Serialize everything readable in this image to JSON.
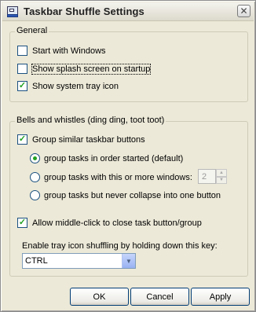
{
  "window": {
    "title": "Taskbar Shuffle Settings",
    "close_glyph": "✕"
  },
  "general": {
    "legend": "General",
    "items": [
      {
        "label": "Start with Windows",
        "checked": false
      },
      {
        "label": "Show splash screen on startup",
        "checked": false
      },
      {
        "label": "Show system tray icon",
        "checked": true
      }
    ]
  },
  "bells": {
    "legend": "Bells and whistles (ding ding, toot toot)",
    "group_similar": {
      "label": "Group similar taskbar buttons",
      "checked": true
    },
    "radios": [
      {
        "label": "group tasks in order started (default)",
        "selected": true
      },
      {
        "label": "group tasks with this or more windows:",
        "selected": false
      },
      {
        "label": "group tasks but never collapse into one button",
        "selected": false
      }
    ],
    "window_count": "2",
    "middle_click": {
      "label": "Allow middle-click to close task button/group",
      "checked": true
    },
    "tray_shuffle_label": "Enable tray icon shuffling by holding down this key:",
    "key_select_value": "CTRL"
  },
  "buttons": {
    "ok": "OK",
    "cancel": "Cancel",
    "apply": "Apply"
  },
  "colors": {
    "check_green": "#21a121",
    "control_border": "#1c5180",
    "dialog_bg": "#ece9d8"
  }
}
